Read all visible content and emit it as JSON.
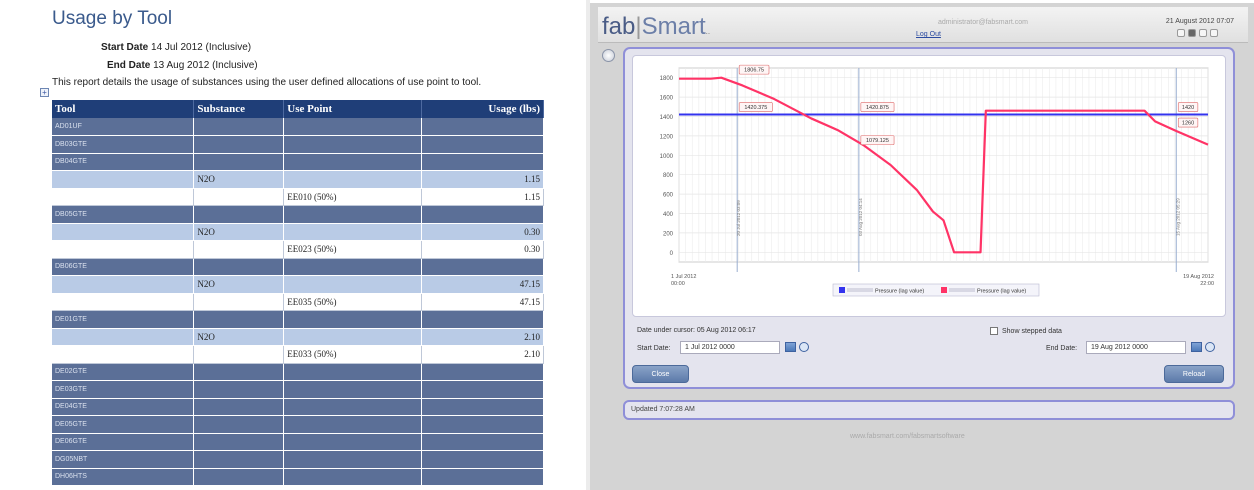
{
  "report": {
    "title": "Usage by Tool",
    "start_label": "Start Date",
    "start_value": "14 Jul 2012 (Inclusive)",
    "end_label": "End Date",
    "end_value": "13 Aug 2012 (Inclusive)",
    "description": "This report details the usage of substances using the user defined allocations of use point to tool.",
    "columns": [
      "Tool",
      "Substance",
      "Use Point",
      "Usage (lbs)"
    ],
    "rows": [
      {
        "kind": "tool",
        "tool": "AD01UF"
      },
      {
        "kind": "tool",
        "tool": "DB03GTE"
      },
      {
        "kind": "tool",
        "tool": "DB04GTE"
      },
      {
        "kind": "subst",
        "substance": "N2O",
        "usage": "1.15"
      },
      {
        "kind": "use",
        "use_point": "EE010 (50%)",
        "usage": "1.15"
      },
      {
        "kind": "tool",
        "tool": "DB05GTE"
      },
      {
        "kind": "subst",
        "substance": "N2O",
        "usage": "0.30"
      },
      {
        "kind": "use",
        "use_point": "EE023 (50%)",
        "usage": "0.30"
      },
      {
        "kind": "tool",
        "tool": "DB06GTE"
      },
      {
        "kind": "subst",
        "substance": "N2O",
        "usage": "47.15"
      },
      {
        "kind": "use",
        "use_point": "EE035 (50%)",
        "usage": "47.15"
      },
      {
        "kind": "tool",
        "tool": "DE01GTE"
      },
      {
        "kind": "subst",
        "substance": "N2O",
        "usage": "2.10"
      },
      {
        "kind": "use",
        "use_point": "EE033 (50%)",
        "usage": "2.10"
      },
      {
        "kind": "tool",
        "tool": "DE02GTE"
      },
      {
        "kind": "tool",
        "tool": "DE03GTE"
      },
      {
        "kind": "tool",
        "tool": "DE04GTE"
      },
      {
        "kind": "tool",
        "tool": "DE05GTE"
      },
      {
        "kind": "tool",
        "tool": "DE06GTE"
      },
      {
        "kind": "tool",
        "tool": "DG05NBT"
      },
      {
        "kind": "tool",
        "tool": "DH06HTS"
      }
    ]
  },
  "app": {
    "logo_fab": "fab",
    "logo_smart": "Smart",
    "logo_tm": "..",
    "user": "administrator@fabsmart.com",
    "logout": "Log Out",
    "date": "21 August 2012 07:07",
    "cursor_label": "Date under cursor: 05 Aug 2012 06:17",
    "show_stepped": "Show stepped data",
    "start_date_label": "Start Date:",
    "start_date_value": "1 Jul 2012 0000",
    "end_date_label": "End Date:",
    "end_date_value": "19 Aug 2012 0000",
    "close_button": "Close",
    "reload_button": "Reload",
    "status": "Updated 7:07:28 AM",
    "footer": "www.fabsmart.com/fabsmartsoftware",
    "colors": {
      "series_blue": "#3333ee",
      "series_red": "#ff3366",
      "panel_border": "#8f8fd8"
    }
  },
  "chart_data": {
    "type": "line",
    "x_start_label": "1 Jul 2012\n00:00",
    "x_end_label": "19 Aug 2012\n22:00",
    "ylim": [
      -100,
      1900
    ],
    "yticks": [
      "1800",
      "1600",
      "1400",
      "1200",
      "1000",
      "800",
      "600",
      "400",
      "200",
      "0"
    ],
    "legend": [
      "Pressure (lag value)",
      "Pressure (lag value)"
    ],
    "series": [
      {
        "name": "Pressure (lag value)",
        "color": "#3333ee",
        "x": [
          0,
          100
        ],
        "values": [
          1420,
          1420
        ]
      },
      {
        "name": "Pressure (lag value)",
        "color": "#ff3366",
        "x": [
          0,
          6,
          8,
          12,
          18,
          25,
          30,
          35,
          40,
          45,
          48,
          50,
          52,
          57,
          58,
          62,
          70,
          80,
          88,
          90,
          94,
          100
        ],
        "values": [
          1790,
          1790,
          1800,
          1720,
          1580,
          1380,
          1260,
          1100,
          900,
          640,
          420,
          330,
          0,
          0,
          1460,
          1460,
          1460,
          1460,
          1460,
          1350,
          1250,
          1110
        ]
      }
    ],
    "markers": [
      {
        "x": 11,
        "label": "20 Jul 2012 03:09"
      },
      {
        "x": 34,
        "label": "03 Aug 2012 04:14"
      },
      {
        "x": 94,
        "label": "15 Aug 2012 05:29"
      }
    ],
    "annotations": [
      {
        "text": "1806.75",
        "at_x": 11,
        "at_y": 1806
      },
      {
        "text": "1420.375",
        "at_x": 11,
        "at_y": 1420
      },
      {
        "text": "1420.875",
        "at_x": 34,
        "at_y": 1420
      },
      {
        "text": "1079.125",
        "at_x": 34,
        "at_y": 1079
      },
      {
        "text": "1420",
        "at_x": 94,
        "at_y": 1420
      },
      {
        "text": "1260",
        "at_x": 94,
        "at_y": 1260
      }
    ]
  }
}
